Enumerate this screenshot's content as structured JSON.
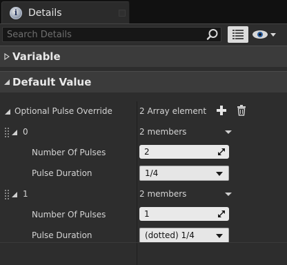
{
  "tab": {
    "title": "Details",
    "icon": "info-icon"
  },
  "search": {
    "placeholder": "Search Details",
    "value": ""
  },
  "toolbar": {
    "view_options_icon": "grid-list-icon",
    "visibility_icon": "eye-icon"
  },
  "categories": [
    {
      "label": "Variable",
      "expanded": false
    },
    {
      "label": "Default Value",
      "expanded": true
    }
  ],
  "property": {
    "name": "Optional Pulse Override",
    "value": "2 Array element",
    "add_icon": "plus-icon",
    "clear_icon": "trash-icon"
  },
  "elements": [
    {
      "index": "0",
      "summary": "2 members",
      "pulses_label": "Number Of Pulses",
      "pulses_value": "2",
      "duration_label": "Pulse Duration",
      "duration_value": "1/4"
    },
    {
      "index": "1",
      "summary": "2 members",
      "pulses_label": "Number Of Pulses",
      "pulses_value": "1",
      "duration_label": "Pulse Duration",
      "duration_value": "(dotted) 1/4"
    }
  ],
  "colors": {
    "panel_bg": "#2d2d2d",
    "category_bg": "#3b3b3b",
    "field_bg": "#e9e9e9"
  }
}
